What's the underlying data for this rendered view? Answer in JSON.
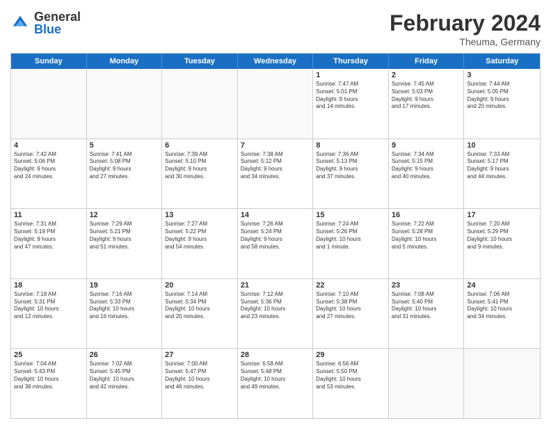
{
  "logo": {
    "general": "General",
    "blue": "Blue"
  },
  "title": {
    "month": "February 2024",
    "location": "Theuma, Germany"
  },
  "headers": [
    "Sunday",
    "Monday",
    "Tuesday",
    "Wednesday",
    "Thursday",
    "Friday",
    "Saturday"
  ],
  "rows": [
    [
      {
        "day": "",
        "info": ""
      },
      {
        "day": "",
        "info": ""
      },
      {
        "day": "",
        "info": ""
      },
      {
        "day": "",
        "info": ""
      },
      {
        "day": "1",
        "info": "Sunrise: 7:47 AM\nSunset: 5:01 PM\nDaylight: 9 hours\nand 14 minutes."
      },
      {
        "day": "2",
        "info": "Sunrise: 7:45 AM\nSunset: 5:03 PM\nDaylight: 9 hours\nand 17 minutes."
      },
      {
        "day": "3",
        "info": "Sunrise: 7:44 AM\nSunset: 5:05 PM\nDaylight: 9 hours\nand 20 minutes."
      }
    ],
    [
      {
        "day": "4",
        "info": "Sunrise: 7:42 AM\nSunset: 5:06 PM\nDaylight: 9 hours\nand 24 minutes."
      },
      {
        "day": "5",
        "info": "Sunrise: 7:41 AM\nSunset: 5:08 PM\nDaylight: 9 hours\nand 27 minutes."
      },
      {
        "day": "6",
        "info": "Sunrise: 7:39 AM\nSunset: 5:10 PM\nDaylight: 9 hours\nand 30 minutes."
      },
      {
        "day": "7",
        "info": "Sunrise: 7:38 AM\nSunset: 5:12 PM\nDaylight: 9 hours\nand 34 minutes."
      },
      {
        "day": "8",
        "info": "Sunrise: 7:36 AM\nSunset: 5:13 PM\nDaylight: 9 hours\nand 37 minutes."
      },
      {
        "day": "9",
        "info": "Sunrise: 7:34 AM\nSunset: 5:15 PM\nDaylight: 9 hours\nand 40 minutes."
      },
      {
        "day": "10",
        "info": "Sunrise: 7:33 AM\nSunset: 5:17 PM\nDaylight: 9 hours\nand 44 minutes."
      }
    ],
    [
      {
        "day": "11",
        "info": "Sunrise: 7:31 AM\nSunset: 5:19 PM\nDaylight: 9 hours\nand 47 minutes."
      },
      {
        "day": "12",
        "info": "Sunrise: 7:29 AM\nSunset: 5:21 PM\nDaylight: 9 hours\nand 51 minutes."
      },
      {
        "day": "13",
        "info": "Sunrise: 7:27 AM\nSunset: 5:22 PM\nDaylight: 9 hours\nand 54 minutes."
      },
      {
        "day": "14",
        "info": "Sunrise: 7:26 AM\nSunset: 5:24 PM\nDaylight: 9 hours\nand 58 minutes."
      },
      {
        "day": "15",
        "info": "Sunrise: 7:24 AM\nSunset: 5:26 PM\nDaylight: 10 hours\nand 1 minute."
      },
      {
        "day": "16",
        "info": "Sunrise: 7:22 AM\nSunset: 5:28 PM\nDaylight: 10 hours\nand 5 minutes."
      },
      {
        "day": "17",
        "info": "Sunrise: 7:20 AM\nSunset: 5:29 PM\nDaylight: 10 hours\nand 9 minutes."
      }
    ],
    [
      {
        "day": "18",
        "info": "Sunrise: 7:18 AM\nSunset: 5:31 PM\nDaylight: 10 hours\nand 12 minutes."
      },
      {
        "day": "19",
        "info": "Sunrise: 7:16 AM\nSunset: 5:33 PM\nDaylight: 10 hours\nand 16 minutes."
      },
      {
        "day": "20",
        "info": "Sunrise: 7:14 AM\nSunset: 5:34 PM\nDaylight: 10 hours\nand 20 minutes."
      },
      {
        "day": "21",
        "info": "Sunrise: 7:12 AM\nSunset: 5:36 PM\nDaylight: 10 hours\nand 23 minutes."
      },
      {
        "day": "22",
        "info": "Sunrise: 7:10 AM\nSunset: 5:38 PM\nDaylight: 10 hours\nand 27 minutes."
      },
      {
        "day": "23",
        "info": "Sunrise: 7:08 AM\nSunset: 5:40 PM\nDaylight: 10 hours\nand 31 minutes."
      },
      {
        "day": "24",
        "info": "Sunrise: 7:06 AM\nSunset: 5:41 PM\nDaylight: 10 hours\nand 34 minutes."
      }
    ],
    [
      {
        "day": "25",
        "info": "Sunrise: 7:04 AM\nSunset: 5:43 PM\nDaylight: 10 hours\nand 38 minutes."
      },
      {
        "day": "26",
        "info": "Sunrise: 7:02 AM\nSunset: 5:45 PM\nDaylight: 10 hours\nand 42 minutes."
      },
      {
        "day": "27",
        "info": "Sunrise: 7:00 AM\nSunset: 5:47 PM\nDaylight: 10 hours\nand 46 minutes."
      },
      {
        "day": "28",
        "info": "Sunrise: 6:58 AM\nSunset: 5:48 PM\nDaylight: 10 hours\nand 49 minutes."
      },
      {
        "day": "29",
        "info": "Sunrise: 6:56 AM\nSunset: 5:50 PM\nDaylight: 10 hours\nand 53 minutes."
      },
      {
        "day": "",
        "info": ""
      },
      {
        "day": "",
        "info": ""
      }
    ]
  ]
}
